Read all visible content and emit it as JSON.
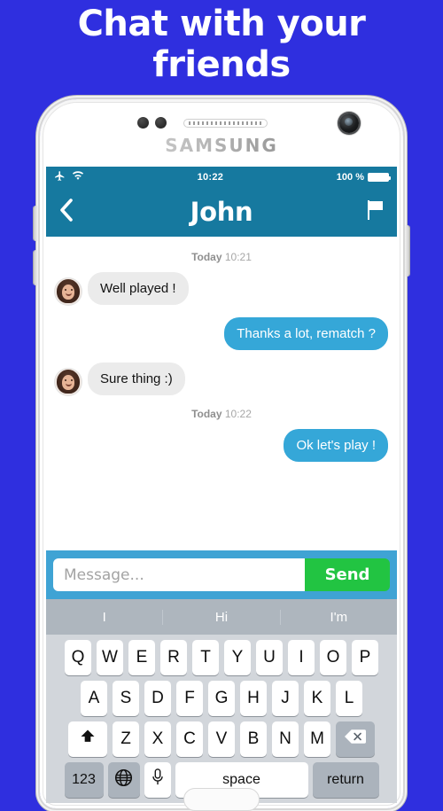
{
  "headline": {
    "line1": "Chat with your",
    "line2": "friends"
  },
  "theme": {
    "background": "#2f2fdf",
    "navbar": "#16799f",
    "bubble_out": "#35a7d8",
    "bubble_in": "#ebebeb",
    "send_button": "#22c442",
    "input_bar": "#3fa3d4",
    "keyboard_bg": "#d2d6db",
    "suggestion_bg": "#aeb6be"
  },
  "phone": {
    "brand": "SAMSUNG"
  },
  "status_bar": {
    "airplane_icon": "airplane-icon",
    "wifi_icon": "wifi-icon",
    "time": "10:22",
    "battery_percent": "100 %",
    "battery_icon": "battery-full-icon"
  },
  "navbar": {
    "back_icon": "chevron-left-icon",
    "title": "John",
    "flag_icon": "flag-icon"
  },
  "chat": {
    "groups": [
      {
        "stamp_label": "Today",
        "stamp_time": "10:21",
        "messages": [
          {
            "direction": "in",
            "text": "Well played !",
            "avatar": "contact-avatar"
          },
          {
            "direction": "out",
            "text": "Thanks a lot, rematch ?"
          },
          {
            "direction": "in",
            "text": "Sure thing :)",
            "avatar": "contact-avatar"
          }
        ]
      },
      {
        "stamp_label": "Today",
        "stamp_time": "10:22",
        "messages": [
          {
            "direction": "out",
            "text": "Ok let's play !"
          }
        ]
      }
    ]
  },
  "input_bar": {
    "placeholder": "Message...",
    "value": "",
    "send_label": "Send"
  },
  "keyboard": {
    "suggestions": [
      "I",
      "Hi",
      "I'm"
    ],
    "row1": [
      "Q",
      "W",
      "E",
      "R",
      "T",
      "Y",
      "U",
      "I",
      "O",
      "P"
    ],
    "row2": [
      "A",
      "S",
      "D",
      "F",
      "G",
      "H",
      "J",
      "K",
      "L"
    ],
    "row3": [
      "Z",
      "X",
      "C",
      "V",
      "B",
      "N",
      "M"
    ],
    "shift_icon": "shift-arrow-icon",
    "backspace_icon": "backspace-icon",
    "numbers_label": "123",
    "globe_icon": "globe-icon",
    "mic_icon": "microphone-icon",
    "space_label": "space",
    "return_label": "return"
  }
}
